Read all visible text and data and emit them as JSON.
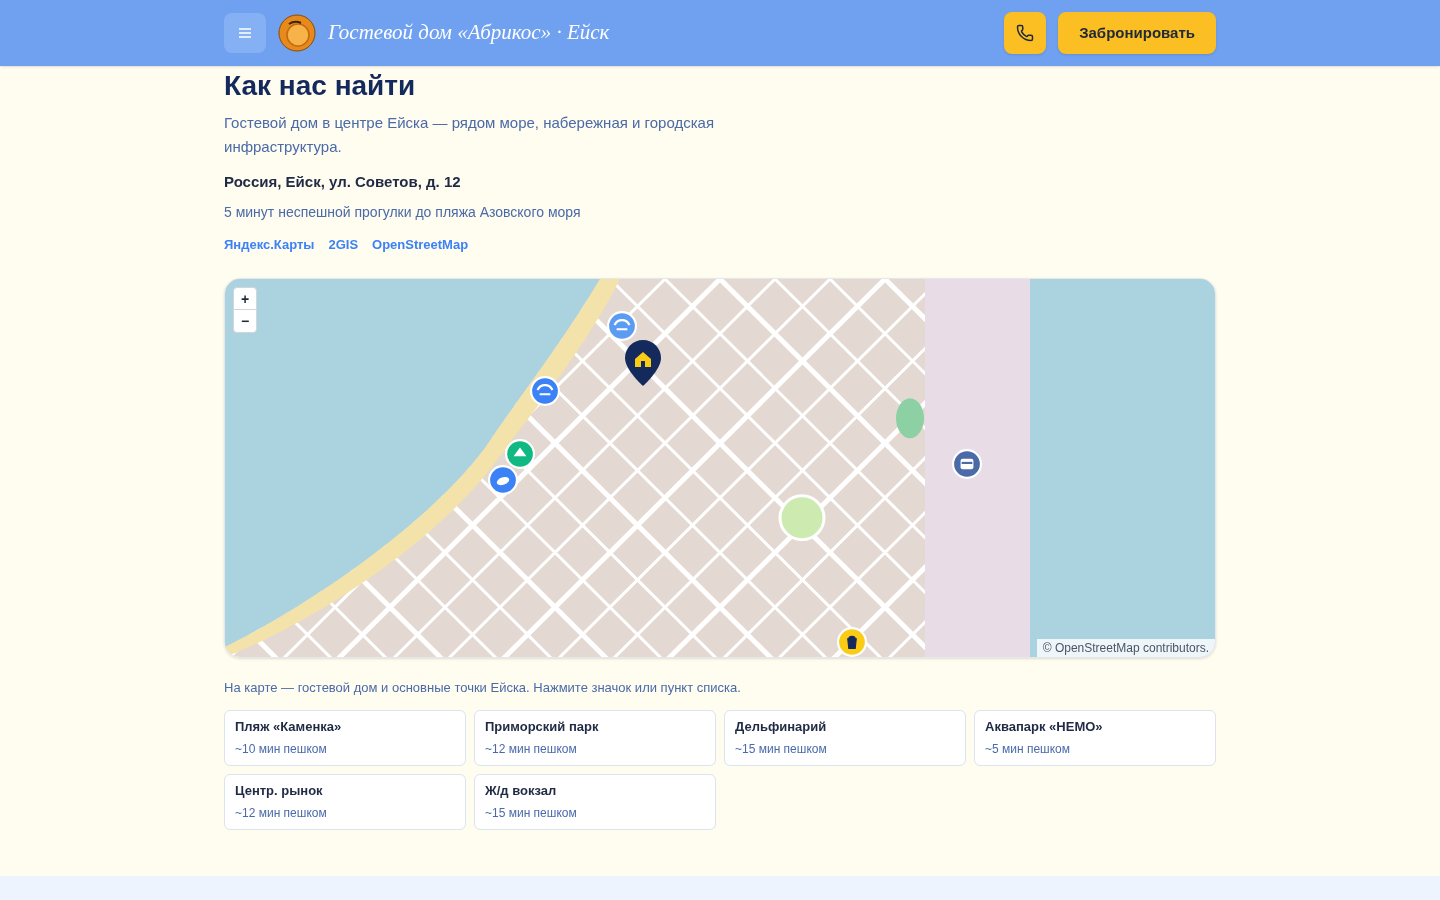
{
  "header": {
    "brand": "Гостевой дом «Абрикос» · Ейск",
    "book_button": "Забронировать"
  },
  "section": {
    "title": "Как нас найти",
    "intro": "Гостевой дом в центре Ейска — рядом море, набережная и городская инфраструктура.",
    "address": "Россия, Ейск, ул. Советов, д. 12",
    "note": "5 минут неспешной прогулки до пляжа Азовского моря",
    "links": [
      "Яндекс.Карты",
      "2GIS",
      "OpenStreetMap"
    ]
  },
  "map": {
    "zoom_in": "+",
    "zoom_out": "−",
    "attribution": "© OpenStreetMap contributors.",
    "markers": [
      {
        "kind": "beach",
        "color": "#5b9cf2"
      },
      {
        "kind": "beach",
        "color": "#3b82f6"
      },
      {
        "kind": "park",
        "color": "#10b981"
      },
      {
        "kind": "dolphin",
        "color": "#3b82f6"
      },
      {
        "kind": "train",
        "color": "#4a6aa8"
      },
      {
        "kind": "market",
        "color": "#facc15"
      },
      {
        "kind": "home",
        "color": "#14295c"
      }
    ]
  },
  "caption": "На карте — гостевой дом и основные точки Ейска. Нажмите значок или пункт списка.",
  "places": [
    {
      "name": "Пляж «Каменка»",
      "time": "~10 мин пешком"
    },
    {
      "name": "Приморский парк",
      "time": "~12 мин пешком"
    },
    {
      "name": "Дельфинарий",
      "time": "~15 мин пешком"
    },
    {
      "name": "Аквапарк «НЕМО»",
      "time": "~5 мин пешком"
    },
    {
      "name": "Центр. рынок",
      "time": "~12 мин пешком"
    },
    {
      "name": "Ж/д вокзал",
      "time": "~15 мин пешком"
    }
  ]
}
